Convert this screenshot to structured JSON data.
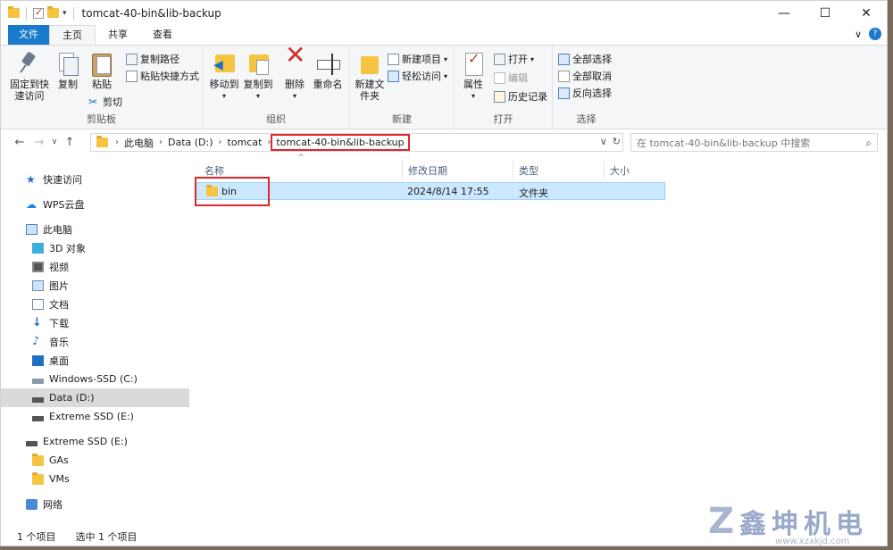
{
  "window": {
    "title": "tomcat-40-bin&lib-backup",
    "controls": {
      "minimize": "—",
      "maximize": "☐",
      "close": "✕"
    }
  },
  "ribbon_tabs": {
    "file": "文件",
    "home": "主页",
    "share": "共享",
    "view": "查看",
    "collapse": "∨",
    "help": "?"
  },
  "ribbon": {
    "clipboard": {
      "label": "剪贴板",
      "pin": "固定到快速访问",
      "copy": "复制",
      "paste": "粘贴",
      "copy_path": "复制路径",
      "paste_shortcut": "粘贴快捷方式",
      "cut": "剪切"
    },
    "organize": {
      "label": "组织",
      "move_to": "移动到",
      "copy_to": "复制到",
      "delete": "删除",
      "rename": "重命名"
    },
    "new": {
      "label": "新建",
      "new_folder": "新建文件夹",
      "new_item": "新建项目",
      "easy_access": "轻松访问"
    },
    "open": {
      "label": "打开",
      "properties": "属性",
      "open": "打开",
      "edit": "编辑",
      "history": "历史记录"
    },
    "select": {
      "label": "选择",
      "select_all": "全部选择",
      "select_none": "全部取消",
      "invert": "反向选择"
    }
  },
  "address": {
    "crumbs": [
      "此电脑",
      "Data (D:)",
      "tomcat",
      "tomcat-40-bin&lib-backup"
    ],
    "search_placeholder": "在 tomcat-40-bin&lib-backup 中搜索"
  },
  "sidebar": {
    "items": [
      {
        "label": "快速访问",
        "icon": "star-icon"
      },
      {
        "label": "WPS云盘",
        "icon": "cloud-icon"
      },
      {
        "label": "此电脑",
        "icon": "computer-icon"
      },
      {
        "label": "3D 对象",
        "icon": "cube-icon"
      },
      {
        "label": "视频",
        "icon": "video-icon"
      },
      {
        "label": "图片",
        "icon": "picture-icon"
      },
      {
        "label": "文档",
        "icon": "document-icon"
      },
      {
        "label": "下载",
        "icon": "download-icon"
      },
      {
        "label": "音乐",
        "icon": "music-icon"
      },
      {
        "label": "桌面",
        "icon": "desktop-icon"
      },
      {
        "label": "Windows-SSD (C:)",
        "icon": "drive-icon"
      },
      {
        "label": "Data (D:)",
        "icon": "drive-icon"
      },
      {
        "label": "Extreme SSD (E:)",
        "icon": "drive-icon"
      },
      {
        "label": "Extreme SSD (E:)",
        "icon": "drive-icon"
      },
      {
        "label": "GAs",
        "icon": "folder-icon"
      },
      {
        "label": "VMs",
        "icon": "folder-icon"
      },
      {
        "label": "网络",
        "icon": "network-icon"
      }
    ]
  },
  "file_list": {
    "columns": [
      "名称",
      "修改日期",
      "类型",
      "大小"
    ],
    "rows": [
      {
        "name": "bin",
        "modified": "2024/8/14 17:55",
        "type": "文件夹",
        "size": ""
      }
    ]
  },
  "status": {
    "count": "1 个项目",
    "selected": "选中 1 个项目"
  },
  "watermark": {
    "text": "鑫坤机电",
    "url": "www.xzxkjd.com"
  },
  "colors": {
    "accent": "#1979ca",
    "selection": "#cce8ff",
    "highlight_box": "#e0262b"
  }
}
